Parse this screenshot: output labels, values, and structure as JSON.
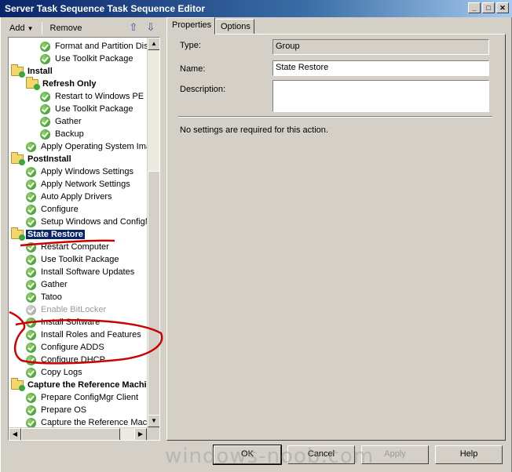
{
  "window": {
    "title": "Server Task Sequence Task Sequence Editor"
  },
  "toolbar": {
    "add_label": "Add",
    "remove_label": "Remove"
  },
  "tree": {
    "items": [
      {
        "label": "Format and Partition Disk",
        "type": "step",
        "depth": 2
      },
      {
        "label": "Use Toolkit Package",
        "type": "step",
        "depth": 2
      },
      {
        "label": "Install",
        "type": "group",
        "depth": 0
      },
      {
        "label": "Refresh Only",
        "type": "group",
        "depth": 1
      },
      {
        "label": "Restart to Windows PE",
        "type": "step",
        "depth": 2
      },
      {
        "label": "Use Toolkit Package",
        "type": "step",
        "depth": 2
      },
      {
        "label": "Gather",
        "type": "step",
        "depth": 2
      },
      {
        "label": "Backup",
        "type": "step",
        "depth": 2
      },
      {
        "label": "Apply Operating System Image",
        "type": "step",
        "depth": 1
      },
      {
        "label": "PostInstall",
        "type": "group",
        "depth": 0
      },
      {
        "label": "Apply Windows Settings",
        "type": "step",
        "depth": 1
      },
      {
        "label": "Apply Network Settings",
        "type": "step",
        "depth": 1
      },
      {
        "label": "Auto Apply Drivers",
        "type": "step",
        "depth": 1
      },
      {
        "label": "Configure",
        "type": "step",
        "depth": 1
      },
      {
        "label": "Setup Windows and ConfigMgr",
        "type": "step",
        "depth": 1
      },
      {
        "label": "State Restore",
        "type": "group",
        "depth": 0,
        "selected": true
      },
      {
        "label": "Restart Computer",
        "type": "step",
        "depth": 1
      },
      {
        "label": "Use Toolkit Package",
        "type": "step",
        "depth": 1
      },
      {
        "label": "Install Software Updates",
        "type": "step",
        "depth": 1
      },
      {
        "label": "Gather",
        "type": "step",
        "depth": 1
      },
      {
        "label": "Tatoo",
        "type": "step",
        "depth": 1
      },
      {
        "label": "Enable BitLocker",
        "type": "step",
        "depth": 1,
        "disabled": true
      },
      {
        "label": "Install Software",
        "type": "step",
        "depth": 1
      },
      {
        "label": "Install Roles and Features",
        "type": "step",
        "depth": 1
      },
      {
        "label": "Configure ADDS",
        "type": "step",
        "depth": 1
      },
      {
        "label": "Configure DHCP",
        "type": "step",
        "depth": 1
      },
      {
        "label": "Copy Logs",
        "type": "step",
        "depth": 1
      },
      {
        "label": "Capture the Reference Machine",
        "type": "group",
        "depth": 0
      },
      {
        "label": "Prepare ConfigMgr Client",
        "type": "step",
        "depth": 1
      },
      {
        "label": "Prepare OS",
        "type": "step",
        "depth": 1
      },
      {
        "label": "Capture the Reference Machine",
        "type": "step",
        "depth": 1
      }
    ]
  },
  "tabs": {
    "properties": "Properties",
    "options": "Options"
  },
  "properties": {
    "type_label": "Type:",
    "type_value": "Group",
    "name_label": "Name:",
    "name_value": "State Restore",
    "description_label": "Description:",
    "description_value": "",
    "message": "No settings are required  for this action."
  },
  "buttons": {
    "ok": "OK",
    "cancel": "Cancel",
    "apply": "Apply",
    "help": "Help"
  },
  "watermark": "windows-noob.com",
  "colors": {
    "title_bar": "#0a246a",
    "selection": "#0a246a",
    "annotation": "#cc0000"
  }
}
